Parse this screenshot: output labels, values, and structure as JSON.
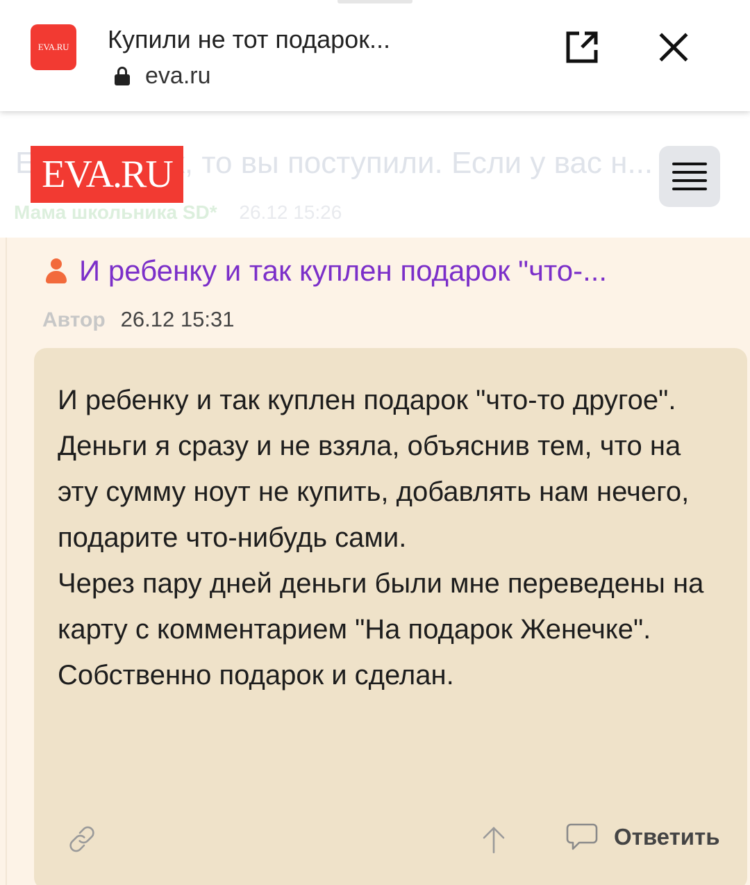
{
  "tab": {
    "favicon_text": "EVA.RU",
    "title": "Купили не тот подарок...",
    "url": "eva.ru",
    "open_external_icon": "open-in-new-icon",
    "close_icon": "close-icon"
  },
  "header": {
    "logo_text": "EVA.RU",
    "ghost_title": "Если вы так, то вы поступили. Если у вас н...",
    "ghost_author": "Мама школьника SD*",
    "ghost_date": "26.12 15:26",
    "menu_icon": "hamburger-menu-icon"
  },
  "post": {
    "title": "И ребенку и так куплен подарок \"что-...",
    "author_label": "Автор",
    "date": "26.12 15:31",
    "body": [
      "И ребенку и так куплен подарок \"что-то другое\".",
      "Деньги я сразу и не взяла, объяснив тем, что на эту сумму ноут не купить, добавлять нам нечего, подарите что-нибудь сами.",
      "Через пару дней деньги были мне переведены на карту с комментарием \"На подарок Женечке\". Собственно подарок и сделан."
    ],
    "reply_label": "Ответить"
  },
  "colors": {
    "brand": "#f23a32",
    "title_purple": "#7b2fc9",
    "user_icon": "#f26a3c",
    "thread_bg": "#fdf3e7",
    "card_bg": "#efe2c9"
  }
}
